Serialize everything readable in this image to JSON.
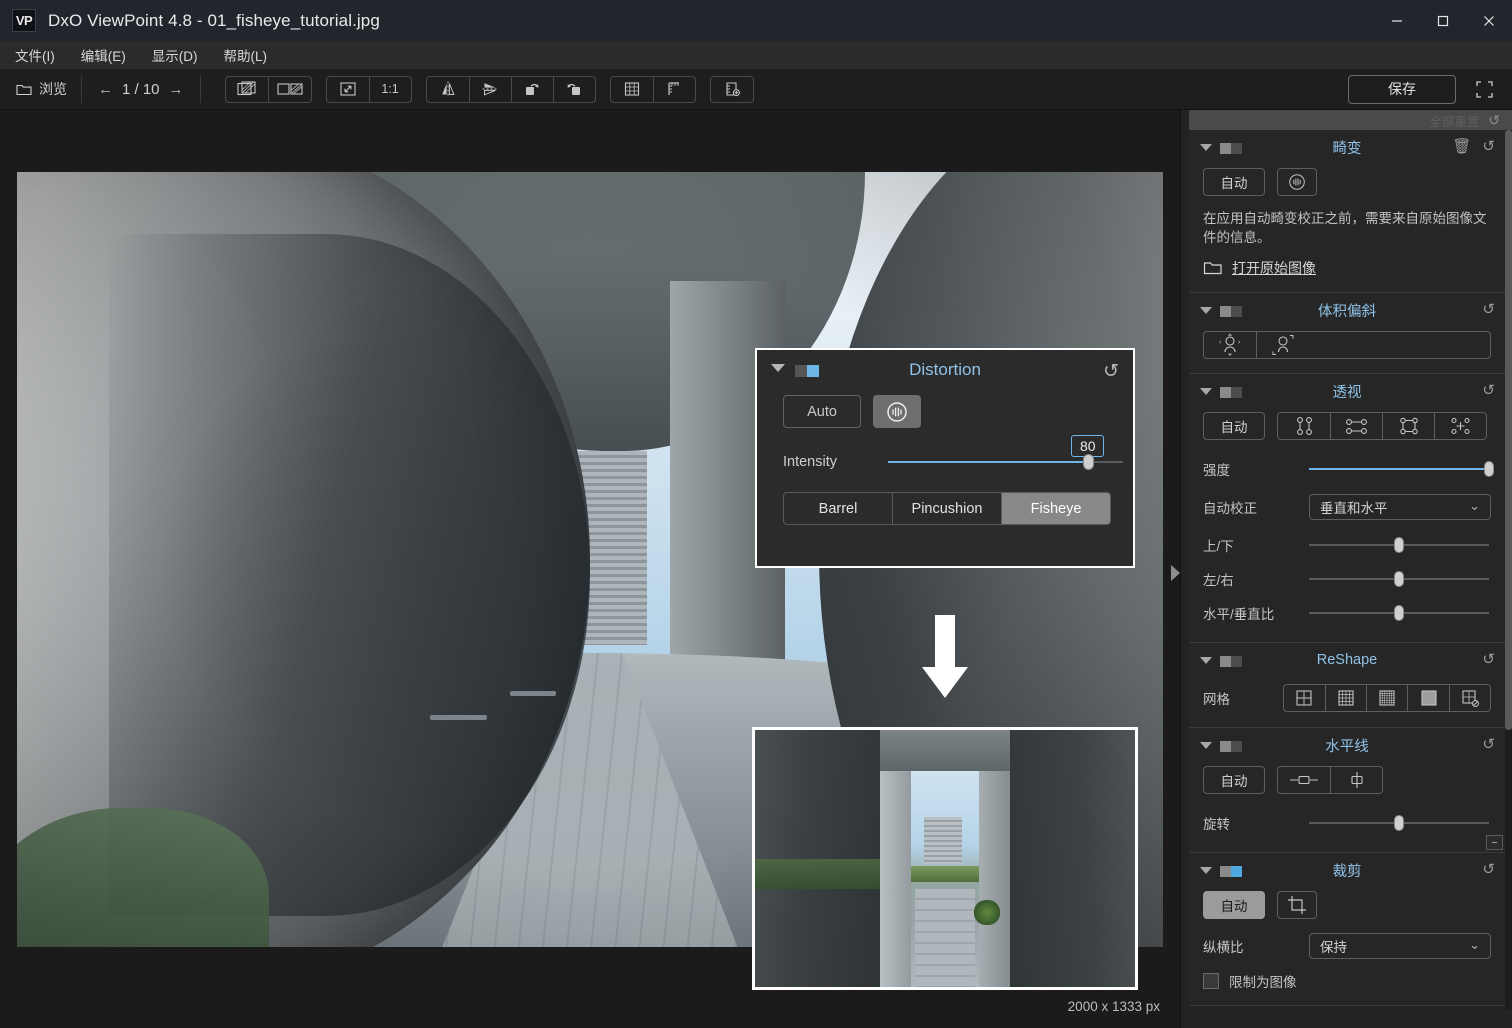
{
  "window": {
    "logo": "VP",
    "title": "DxO ViewPoint 4.8 - 01_fisheye_tutorial.jpg",
    "minimize": "—",
    "maximize": "□",
    "close": "✕"
  },
  "menubar": {
    "items": [
      {
        "label": "文件(I)"
      },
      {
        "label": "编辑(E)"
      },
      {
        "label": "显示(D)"
      },
      {
        "label": "帮助(L)"
      }
    ]
  },
  "toolbar": {
    "browse_label": "浏览",
    "browse_icon": "folder-icon",
    "prev_arrow": "←",
    "counter": "1 / 10",
    "next_arrow": "→",
    "compare_split_icon": "compare-split-icon",
    "compare_side_icon": "compare-side-by-side-icon",
    "fit_icon": "fit-to-screen-icon",
    "zoom_1to1_label": "1:1",
    "flip_h_icon": "flip-horizontal-icon",
    "flip_v_icon": "flip-vertical-icon",
    "rotate_ccw_icon": "rotate-left-icon",
    "rotate_cw_icon": "rotate-right-icon",
    "grid_icon": "grid-overlay-icon",
    "ruler_icon": "ruler-icon",
    "measure_icon": "measure-add-icon",
    "save_label": "保存",
    "fullscreen_icon": "fullscreen-icon"
  },
  "viewer": {
    "dimensions": "2000 x 1333 px"
  },
  "distortion_popup": {
    "title": "Distortion",
    "toggle_state": "on",
    "reset_icon": "reset-arrow-icon",
    "caret_icon": "chevron-down-icon",
    "auto_label": "Auto",
    "lens_icon": "lens-distortion-icon",
    "intensity_label": "Intensity",
    "intensity_value": "80",
    "modes": [
      {
        "label": "Barrel",
        "active": false
      },
      {
        "label": "Pincushion",
        "active": false
      },
      {
        "label": "Fisheye",
        "active": true
      }
    ]
  },
  "annotation": {
    "arrow_icon": "down-arrow-icon"
  },
  "right_panel": {
    "reset_all_label": "全部重置",
    "reset_all_icon": "reset-arrow-icon",
    "collapse_icon": "panel-collapse-icon",
    "sections": [
      {
        "id": "distortion",
        "title": "畸变",
        "toggle": "off",
        "delete_icon": "trash-icon",
        "reset_icon": "reset-arrow-icon",
        "auto_label": "自动",
        "lens_icon": "lens-distortion-icon",
        "note": "在应用自动畸变校正之前，需要来自原始图像文件的信息。",
        "open_raw_label": "打开原始图像",
        "open_raw_icon": "folder-open-icon"
      },
      {
        "id": "volumetric",
        "title": "体积偏斜",
        "toggle": "off",
        "reset_icon": "reset-arrow-icon",
        "icon_1": "volume-deformation-icon",
        "icon_2": "volume-person-icon"
      },
      {
        "id": "perspective",
        "title": "透视",
        "toggle": "off",
        "reset_icon": "reset-arrow-icon",
        "auto_label": "自动",
        "icon_vertical": "perspective-vertical-icon",
        "icon_horizontal": "perspective-horizontal-icon",
        "icon_rectangle": "perspective-rectangle-icon",
        "icon_8points": "perspective-8-points-icon",
        "intensity_label": "强度",
        "intensity_percent": 100,
        "auto_correct_label": "自动校正",
        "auto_correct_value": "垂直和水平",
        "updown_label": "上/下",
        "updown_percent": 50,
        "leftright_label": "左/右",
        "leftright_percent": 50,
        "aspect_label": "水平/垂直比",
        "aspect_percent": 50
      },
      {
        "id": "reshape",
        "title": "ReShape",
        "toggle": "off",
        "reset_icon": "reset-arrow-icon",
        "grid_label": "网格",
        "grid_2x2_icon": "grid-2x2-icon",
        "grid_4x4_icon": "grid-4x4-icon",
        "grid_6x6_icon": "grid-6x6-icon",
        "grid_dense_icon": "grid-dense-icon",
        "grid_hide_icon": "grid-hide-icon"
      },
      {
        "id": "horizon",
        "title": "水平线",
        "toggle": "off",
        "reset_icon": "reset-arrow-icon",
        "auto_label": "自动",
        "horizon_line_icon": "horizon-line-icon",
        "horizon_vertical_icon": "horizon-vertical-icon",
        "rotation_label": "旋转",
        "rotation_percent": 50,
        "minus_label": "−"
      },
      {
        "id": "crop",
        "title": "裁剪",
        "toggle": "on",
        "reset_icon": "reset-arrow-icon",
        "auto_label": "自动",
        "crop_icon": "crop-icon",
        "aspect_label": "纵横比",
        "aspect_value": "保持",
        "constrain_label": "限制为图像",
        "constrain_checked": false
      }
    ]
  }
}
